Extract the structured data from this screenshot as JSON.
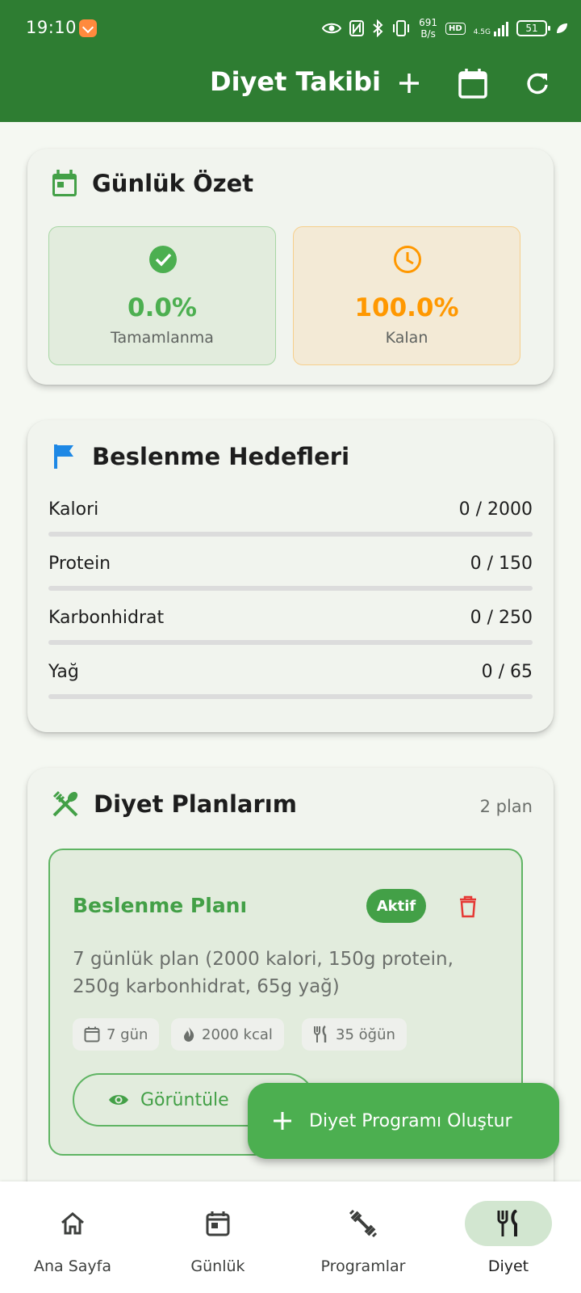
{
  "status_bar": {
    "time": "19:10",
    "net_speed": "691",
    "net_unit": "B/s",
    "hd": "HD",
    "network": "4.5G",
    "battery": "51"
  },
  "app_bar": {
    "title": "Diyet Takibi",
    "actions": [
      "add-icon",
      "calendar-icon",
      "refresh-icon"
    ]
  },
  "summary": {
    "title": "Günlük Özet",
    "completed": {
      "value": "0.0%",
      "label": "Tamamlanma",
      "color": "#4caf50"
    },
    "remaining": {
      "value": "100.0%",
      "label": "Kalan",
      "color": "#ff9800"
    }
  },
  "goals": {
    "title": "Beslenme Hedefleri",
    "items": [
      {
        "name": "Kalori",
        "amount": "0 / 2000",
        "progress": 0
      },
      {
        "name": "Protein",
        "amount": "0 / 150",
        "progress": 0
      },
      {
        "name": "Karbonhidrat",
        "amount": "0 / 250",
        "progress": 0
      },
      {
        "name": "Yağ",
        "amount": "0 / 65",
        "progress": 0
      }
    ]
  },
  "plans": {
    "title": "Diyet Planlarım",
    "count": "2 plan",
    "items": [
      {
        "name": "Beslenme Planı",
        "badge": "Aktif",
        "description": "7 günlük plan (2000 kalori, 150g protein, 250g karbonhidrat, 65g yağ)",
        "chips": [
          "7 gün",
          "2000 kcal",
          "35 öğün"
        ],
        "view_label": "Görüntüle"
      }
    ]
  },
  "fab": {
    "label": "Diyet Programı Oluştur"
  },
  "bottom_nav": {
    "items": [
      {
        "label": "Ana Sayfa",
        "icon": "home-icon"
      },
      {
        "label": "Günlük",
        "icon": "calendar-today-icon"
      },
      {
        "label": "Programlar",
        "icon": "dumbbell-icon"
      },
      {
        "label": "Diyet",
        "icon": "restaurant-icon",
        "active": true
      }
    ]
  }
}
